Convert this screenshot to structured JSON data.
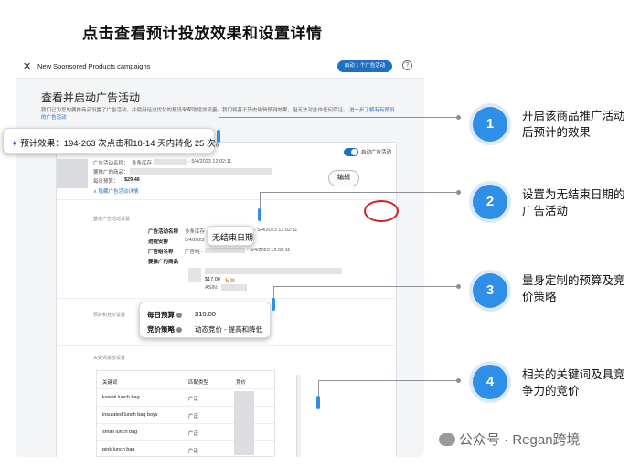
{
  "heading": "点击查看预计投放效果和设置详情",
  "window": {
    "title": "New Sponsored Products campaigns",
    "launch_button": "启动 1 个广告活动",
    "help": "?"
  },
  "page": {
    "title": "查看并启动广告活动",
    "description": "我们已为您的要推商品设置了广告活动，并使用经过优化的预设来帮助增加流量。我们将基于历史编辑预测效果，但无法对此作任何保证。",
    "learn_more": "进一步了解有有预设的广告活动"
  },
  "summary": {
    "toggle_label": "启动广告活动",
    "campaign_name_label": "广告活动名称：",
    "campaign_name_value": "多条库存 - ",
    "campaign_date": "- 5/4/2023 12:02:11",
    "promoted_label": "要推广的商品：",
    "daily_budget_label": "每日预算：",
    "daily_budget_value": "$29.46",
    "hide_details": "∧ 隐藏广告活动详情"
  },
  "details": {
    "section_basic": "基本广告活动设置",
    "edit_button": "编辑",
    "rows": [
      {
        "label": "广告活动名称",
        "value": "多条库存 - "
      },
      {
        "label": "进程安排",
        "value": "5/4/2023"
      },
      {
        "label": "广告组名称",
        "value": "广告组 - "
      },
      {
        "label": "要推广的商品",
        "value": ""
      }
    ],
    "campaign_row_suffix": "- 5/4/2023 12:02:11",
    "schedule_row_suffix": "- 5/4/2023 12:02:11",
    "product_price": "$17.00",
    "product_tag": "标准",
    "asin_label": "ASIN:",
    "section_budget": "预算和竞价设置",
    "section_keywords": "关键词投放设置"
  },
  "keywords": {
    "headers": [
      "关键词",
      "匹配类型",
      "竞价"
    ],
    "rows": [
      {
        "keyword": "kawaii lunch bag",
        "match": "广泛"
      },
      {
        "keyword": "insulated lunch bag boys",
        "match": "广泛"
      },
      {
        "keyword": "small lunch bag",
        "match": "广泛"
      },
      {
        "keyword": "pink lunch bag",
        "match": "广泛"
      }
    ]
  },
  "callouts": {
    "estimate_icon": "✦",
    "estimate_text": "预计效果：194-263 次点击和18-14 天内转化 25 次。",
    "no_end_date": "无结束日期",
    "budget_label": "每日预算",
    "budget_value": "$10.00",
    "bid_label": "竞价策略",
    "bid_value": "动态竞价 - 提高和降低"
  },
  "steps": [
    {
      "number": "1",
      "text": "开启该商品推广活动后预计的效果"
    },
    {
      "number": "2",
      "text": "设置为无结束日期的广告活动"
    },
    {
      "number": "3",
      "text": "量身定制的预算及竞价策略"
    },
    {
      "number": "4",
      "text": "相关的关键词及具竞争力的竞价"
    }
  ],
  "watermark": "公众号 · Regan跨境",
  "colors": {
    "accent_blue": "#2e8fe8",
    "button_blue": "#1f6fc5",
    "highlight_red": "#d0202a"
  }
}
